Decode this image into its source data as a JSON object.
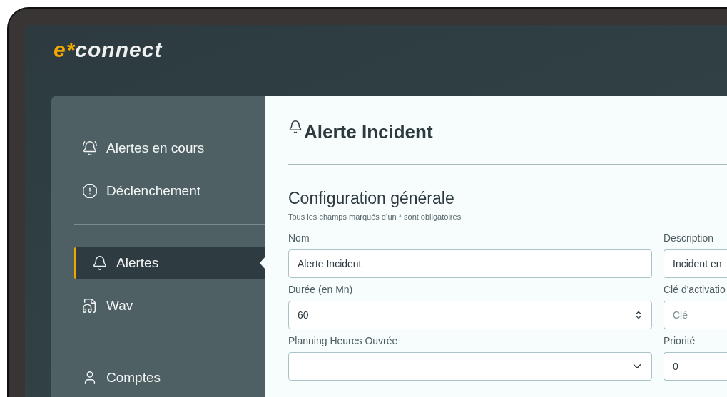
{
  "logo": {
    "accent": "e*",
    "name": "connect"
  },
  "sidebar": {
    "groups": [
      {
        "items": [
          {
            "label": "Alertes en cours",
            "selected": false
          },
          {
            "label": "Déclenchement",
            "selected": false
          }
        ]
      },
      {
        "items": [
          {
            "label": "Alertes",
            "selected": true
          },
          {
            "label": "Wav",
            "selected": false
          }
        ]
      },
      {
        "items": [
          {
            "label": "Comptes",
            "selected": false
          }
        ]
      }
    ]
  },
  "page": {
    "title": "Alerte Incident",
    "section": "Configuration générale",
    "note": "Tous les champs marqués d’un * sont obligatoires"
  },
  "fields": [
    {
      "label": "Nom",
      "kind": "text",
      "value": "Alerte Incident"
    },
    {
      "label": "Description",
      "kind": "text",
      "value": "Incident en"
    },
    {
      "label": "Durée (en Mn)",
      "kind": "number",
      "value": "60"
    },
    {
      "label": "Clé d'activatio",
      "kind": "text",
      "placeholder": "Clé"
    },
    {
      "label": "Planning Heures Ouvrée",
      "kind": "select"
    },
    {
      "label": "Priorité",
      "kind": "text",
      "value": "0"
    }
  ]
}
